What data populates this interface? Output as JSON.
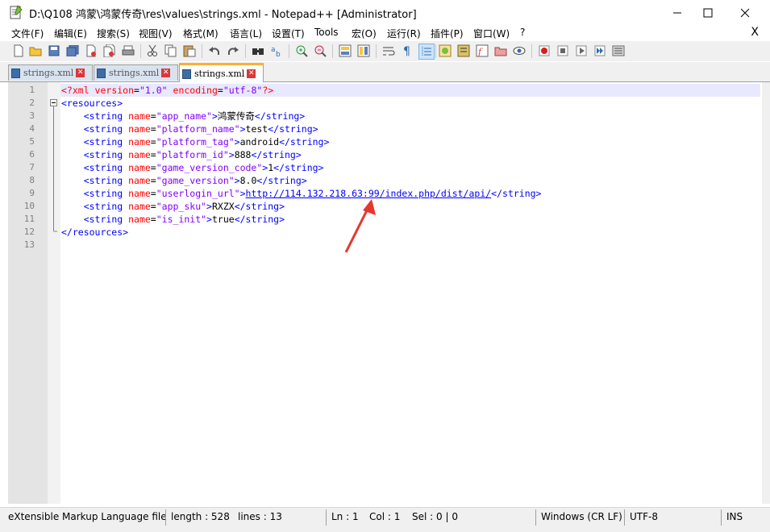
{
  "window": {
    "title": "D:\\Q108 鸿蒙\\鸿蒙传奇\\res\\values\\strings.xml - Notepad++ [Administrator]",
    "minimize": "—",
    "maximize": "☐",
    "close": "✕"
  },
  "menu": {
    "items": [
      "文件(F)",
      "编辑(E)",
      "搜索(S)",
      "视图(V)",
      "格式(M)",
      "语言(L)",
      "设置(T)",
      "Tools",
      "宏(O)",
      "运行(R)",
      "插件(P)",
      "窗口(W)",
      "?"
    ],
    "close": "X"
  },
  "tabs": [
    {
      "label": "strings.xml",
      "active": false
    },
    {
      "label": "strings.xml",
      "active": false
    },
    {
      "label": "strings.xml",
      "active": true
    }
  ],
  "editor": {
    "line_numbers": [
      "1",
      "2",
      "3",
      "4",
      "5",
      "6",
      "7",
      "8",
      "9",
      "10",
      "11",
      "12",
      "13"
    ],
    "lines": [
      [
        {
          "c": "t-decl",
          "t": "<?xml "
        },
        {
          "c": "t-attr",
          "t": "version"
        },
        {
          "c": "t-eq",
          "t": "="
        },
        {
          "c": "t-str",
          "t": "\"1.0\""
        },
        {
          "c": "t-txt",
          "t": " "
        },
        {
          "c": "t-attr",
          "t": "encoding"
        },
        {
          "c": "t-eq",
          "t": "="
        },
        {
          "c": "t-str",
          "t": "\"utf-8\""
        },
        {
          "c": "t-decl",
          "t": "?>"
        }
      ],
      [
        {
          "c": "t-tag",
          "t": "<resources>"
        }
      ],
      [
        {
          "c": "t-txt",
          "t": "    "
        },
        {
          "c": "t-tag",
          "t": "<string "
        },
        {
          "c": "t-attr",
          "t": "name"
        },
        {
          "c": "t-eq",
          "t": "="
        },
        {
          "c": "t-str",
          "t": "\"app_name\""
        },
        {
          "c": "t-tag",
          "t": ">"
        },
        {
          "c": "t-txt",
          "t": "鸿蒙传奇"
        },
        {
          "c": "t-tag",
          "t": "</string>"
        }
      ],
      [
        {
          "c": "t-txt",
          "t": "    "
        },
        {
          "c": "t-tag",
          "t": "<string "
        },
        {
          "c": "t-attr",
          "t": "name"
        },
        {
          "c": "t-eq",
          "t": "="
        },
        {
          "c": "t-str",
          "t": "\"platform_name\""
        },
        {
          "c": "t-tag",
          "t": ">"
        },
        {
          "c": "t-txt",
          "t": "test"
        },
        {
          "c": "t-tag",
          "t": "</string>"
        }
      ],
      [
        {
          "c": "t-txt",
          "t": "    "
        },
        {
          "c": "t-tag",
          "t": "<string "
        },
        {
          "c": "t-attr",
          "t": "name"
        },
        {
          "c": "t-eq",
          "t": "="
        },
        {
          "c": "t-str",
          "t": "\"platform_tag\""
        },
        {
          "c": "t-tag",
          "t": ">"
        },
        {
          "c": "t-txt",
          "t": "android"
        },
        {
          "c": "t-tag",
          "t": "</string>"
        }
      ],
      [
        {
          "c": "t-txt",
          "t": "    "
        },
        {
          "c": "t-tag",
          "t": "<string "
        },
        {
          "c": "t-attr",
          "t": "name"
        },
        {
          "c": "t-eq",
          "t": "="
        },
        {
          "c": "t-str",
          "t": "\"platform_id\""
        },
        {
          "c": "t-tag",
          "t": ">"
        },
        {
          "c": "t-txt",
          "t": "888"
        },
        {
          "c": "t-tag",
          "t": "</string>"
        }
      ],
      [
        {
          "c": "t-txt",
          "t": "    "
        },
        {
          "c": "t-tag",
          "t": "<string "
        },
        {
          "c": "t-attr",
          "t": "name"
        },
        {
          "c": "t-eq",
          "t": "="
        },
        {
          "c": "t-str",
          "t": "\"game_version_code\""
        },
        {
          "c": "t-tag",
          "t": ">"
        },
        {
          "c": "t-txt",
          "t": "1"
        },
        {
          "c": "t-tag",
          "t": "</string>"
        }
      ],
      [
        {
          "c": "t-txt",
          "t": "    "
        },
        {
          "c": "t-tag",
          "t": "<string "
        },
        {
          "c": "t-attr",
          "t": "name"
        },
        {
          "c": "t-eq",
          "t": "="
        },
        {
          "c": "t-str",
          "t": "\"game_version\""
        },
        {
          "c": "t-tag",
          "t": ">"
        },
        {
          "c": "t-txt",
          "t": "8.0"
        },
        {
          "c": "t-tag",
          "t": "</string>"
        }
      ],
      [
        {
          "c": "t-txt",
          "t": "    "
        },
        {
          "c": "t-tag",
          "t": "<string "
        },
        {
          "c": "t-attr",
          "t": "name"
        },
        {
          "c": "t-eq",
          "t": "="
        },
        {
          "c": "t-str",
          "t": "\"userlogin_url\""
        },
        {
          "c": "t-tag",
          "t": ">"
        },
        {
          "c": "t-url",
          "t": "http://114.132.218.63:99/index.php/dist/api/"
        },
        {
          "c": "t-tag",
          "t": "</string>"
        }
      ],
      [
        {
          "c": "t-txt",
          "t": "    "
        },
        {
          "c": "t-tag",
          "t": "<string "
        },
        {
          "c": "t-attr",
          "t": "name"
        },
        {
          "c": "t-eq",
          "t": "="
        },
        {
          "c": "t-str",
          "t": "\"app_sku\""
        },
        {
          "c": "t-tag",
          "t": ">"
        },
        {
          "c": "t-txt",
          "t": "RXZX"
        },
        {
          "c": "t-tag",
          "t": "</string>"
        }
      ],
      [
        {
          "c": "t-txt",
          "t": "    "
        },
        {
          "c": "t-tag",
          "t": "<string "
        },
        {
          "c": "t-attr",
          "t": "name"
        },
        {
          "c": "t-eq",
          "t": "="
        },
        {
          "c": "t-str",
          "t": "\"is_init\""
        },
        {
          "c": "t-tag",
          "t": ">"
        },
        {
          "c": "t-txt",
          "t": "true"
        },
        {
          "c": "t-tag",
          "t": "</string>"
        }
      ],
      [
        {
          "c": "t-tag",
          "t": "</resources>"
        }
      ],
      []
    ]
  },
  "status": {
    "file_type": "eXtensible Markup Language file",
    "length": "length : 528",
    "lines": "lines : 13",
    "ln": "Ln : 1",
    "col": "Col : 1",
    "sel": "Sel : 0 | 0",
    "eol": "Windows (CR LF)",
    "encoding": "UTF-8",
    "mode": "INS"
  },
  "colors": {
    "annotation_arrow": "#e8362c",
    "tag": "#0000ff",
    "attribute": "#ff0000",
    "string_value": "#8000ff"
  }
}
